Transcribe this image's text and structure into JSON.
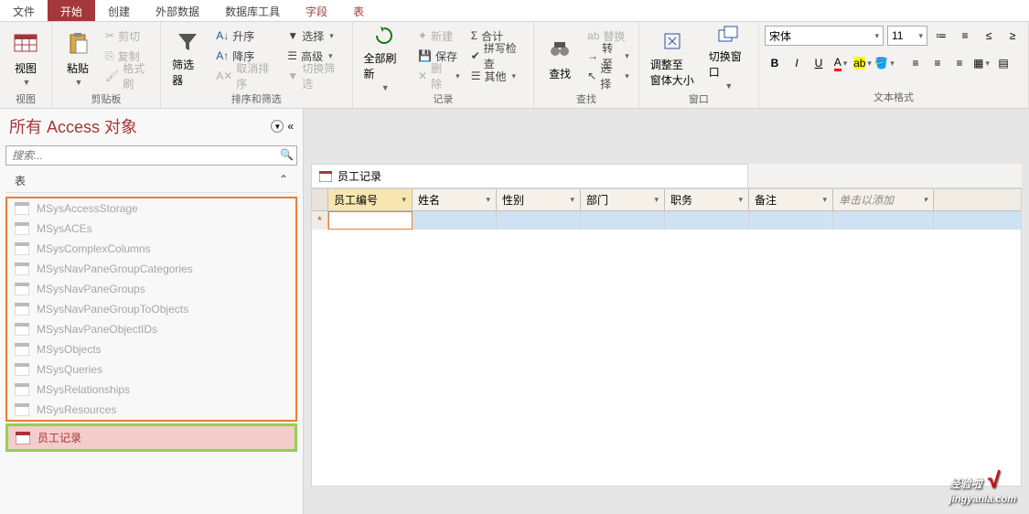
{
  "tabs": {
    "file": "文件",
    "home": "开始",
    "create": "创建",
    "external": "外部数据",
    "dbtools": "数据库工具",
    "fields": "字段",
    "table": "表"
  },
  "ribbon": {
    "view": {
      "label": "视图",
      "group": "视图"
    },
    "clipboard": {
      "paste": "粘贴",
      "cut": "剪切",
      "copy": "复制",
      "format": "格式刷",
      "group": "剪贴板"
    },
    "sortfilter": {
      "filter": "筛选器",
      "asc": "升序",
      "desc": "降序",
      "clear": "取消排序",
      "select": "选择",
      "advanced": "高级",
      "toggle": "切换筛选",
      "group": "排序和筛选"
    },
    "records": {
      "refresh": "全部刷新",
      "new": "新建",
      "save": "保存",
      "delete": "删除",
      "totals": "合计",
      "spell": "拼写检查",
      "more": "其他",
      "group": "记录"
    },
    "find": {
      "find": "查找",
      "replace": "替换",
      "goto": "转至",
      "select": "选择",
      "group": "查找"
    },
    "window": {
      "fit": "调整至\n窗体大小",
      "switch": "切换窗口",
      "group": "窗口"
    },
    "textfmt": {
      "font": "宋体",
      "size": "11",
      "group": "文本格式"
    }
  },
  "nav": {
    "title": "所有 Access 对象",
    "search_placeholder": "搜索...",
    "section": "表",
    "items": [
      "MSysAccessStorage",
      "MSysACEs",
      "MSysComplexColumns",
      "MSysNavPaneGroupCategories",
      "MSysNavPaneGroups",
      "MSysNavPaneGroupToObjects",
      "MSysNavPaneObjectIDs",
      "MSysObjects",
      "MSysQueries",
      "MSysRelationships",
      "MSysResources"
    ],
    "selected": "员工记录"
  },
  "datasheet": {
    "tab_title": "员工记录",
    "columns": [
      "员工编号",
      "姓名",
      "性别",
      "部门",
      "职务",
      "备注"
    ],
    "add_col": "单击以添加"
  },
  "watermark": {
    "main": "经验啦",
    "sub": "jingyanla.com"
  }
}
